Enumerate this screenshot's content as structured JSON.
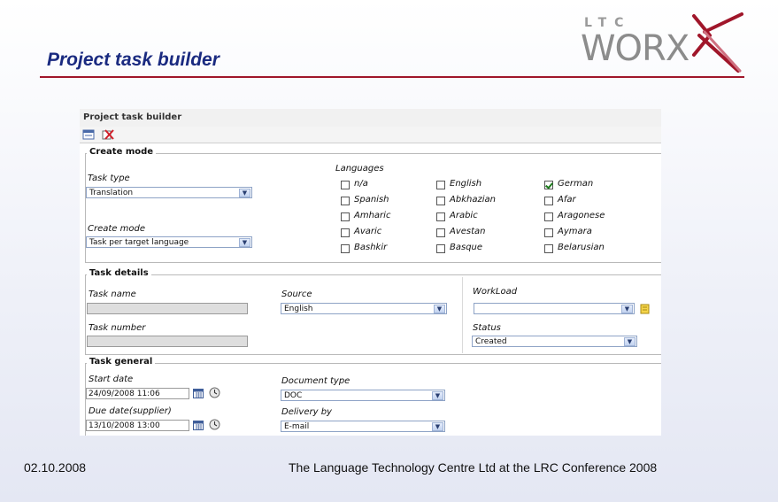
{
  "slide": {
    "title": "Project task builder",
    "logo_top": "LTC",
    "logo_main": "WORX",
    "footer_date": "02.10.2008",
    "footer_text": "The Language Technology Centre Ltd at the LRC Conference 2008",
    "accent_color": "#a0162a",
    "title_color": "#1a2a80"
  },
  "app": {
    "title": "Project task builder",
    "toolbar": {
      "new_icon": "new-window-icon",
      "delete_icon": "delete-icon"
    },
    "create_mode": {
      "legend": "Create mode",
      "task_type_label": "Task type",
      "task_type_value": "Translation",
      "create_mode_label": "Create mode",
      "create_mode_value": "Task per target language",
      "languages_label": "Languages",
      "languages": [
        {
          "name": "n/a",
          "checked": false
        },
        {
          "name": "English",
          "checked": false
        },
        {
          "name": "German",
          "checked": true
        },
        {
          "name": "Spanish",
          "checked": false
        },
        {
          "name": "Abkhazian",
          "checked": false
        },
        {
          "name": "Afar",
          "checked": false
        },
        {
          "name": "Amharic",
          "checked": false
        },
        {
          "name": "Arabic",
          "checked": false
        },
        {
          "name": "Aragonese",
          "checked": false
        },
        {
          "name": "Avaric",
          "checked": false
        },
        {
          "name": "Avestan",
          "checked": false
        },
        {
          "name": "Aymara",
          "checked": false
        },
        {
          "name": "Bashkir",
          "checked": false
        },
        {
          "name": "Basque",
          "checked": false
        },
        {
          "name": "Belarusian",
          "checked": false
        }
      ]
    },
    "task_details": {
      "legend": "Task details",
      "task_name_label": "Task name",
      "task_name_value": "",
      "task_number_label": "Task number",
      "task_number_value": "",
      "source_label": "Source",
      "source_value": "English",
      "workload_label": "WorkLoad",
      "workload_value": "",
      "status_label": "Status",
      "status_value": "Created"
    },
    "task_general": {
      "legend": "Task general",
      "start_date_label": "Start date",
      "start_date_value": "24/09/2008 11:06",
      "due_date_label": "Due date(supplier)",
      "due_date_value": "13/10/2008 13:00",
      "document_type_label": "Document type",
      "document_type_value": "DOC",
      "delivery_by_label": "Delivery by",
      "delivery_by_value": "E-mail"
    }
  }
}
